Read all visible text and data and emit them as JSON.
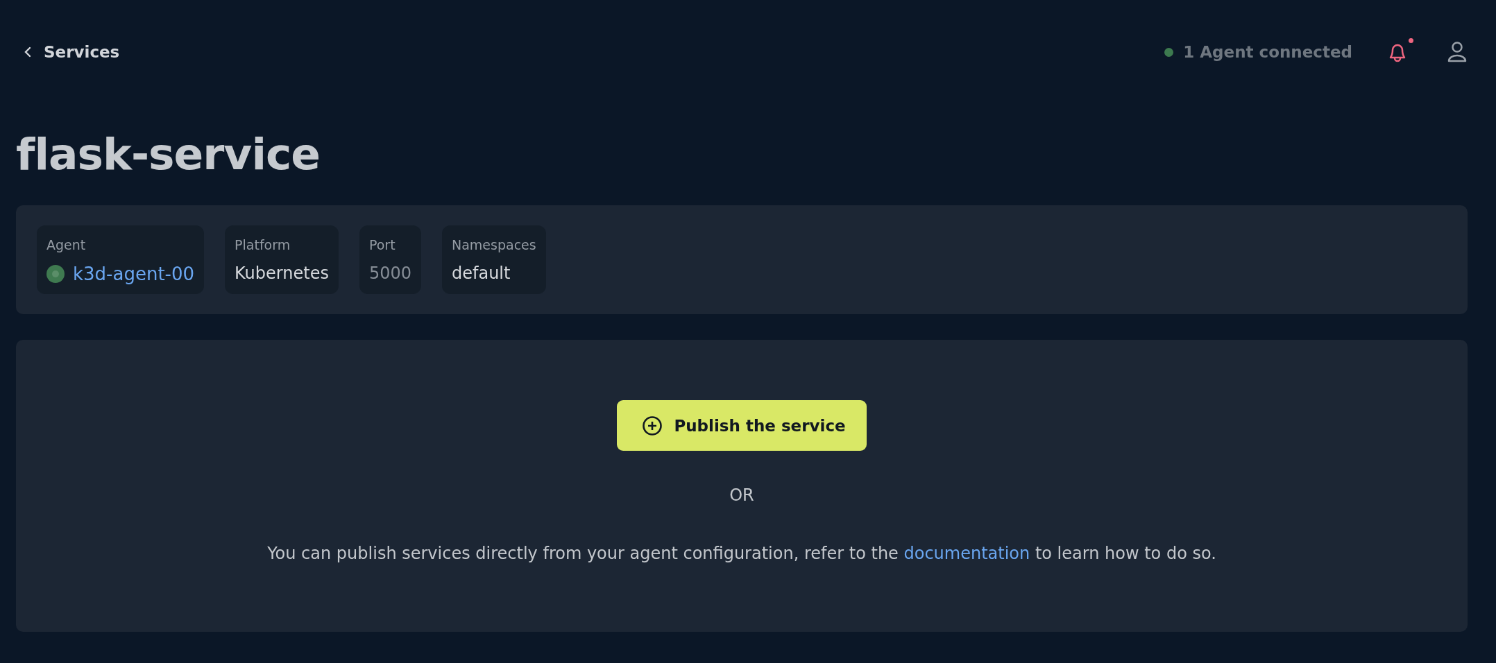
{
  "header": {
    "back_label": "Services",
    "agent_status": {
      "label": "1 Agent connected",
      "connected": true
    },
    "notifications": {
      "unread": true
    }
  },
  "title": "flask-service",
  "details": [
    {
      "kind": "agent",
      "label": "Agent",
      "value": "k3d-agent-00",
      "online": true
    },
    {
      "kind": "text",
      "label": "Platform",
      "value": "Kubernetes"
    },
    {
      "kind": "muted",
      "label": "Port",
      "value": "5000"
    },
    {
      "kind": "text",
      "label": "Namespaces",
      "value": "default"
    }
  ],
  "publish": {
    "button": "Publish the service",
    "separator": "OR",
    "note": {
      "before": "You can publish services directly from your agent configuration, refer to the ",
      "link": "documentation",
      "after": " to learn how to do so."
    }
  }
}
